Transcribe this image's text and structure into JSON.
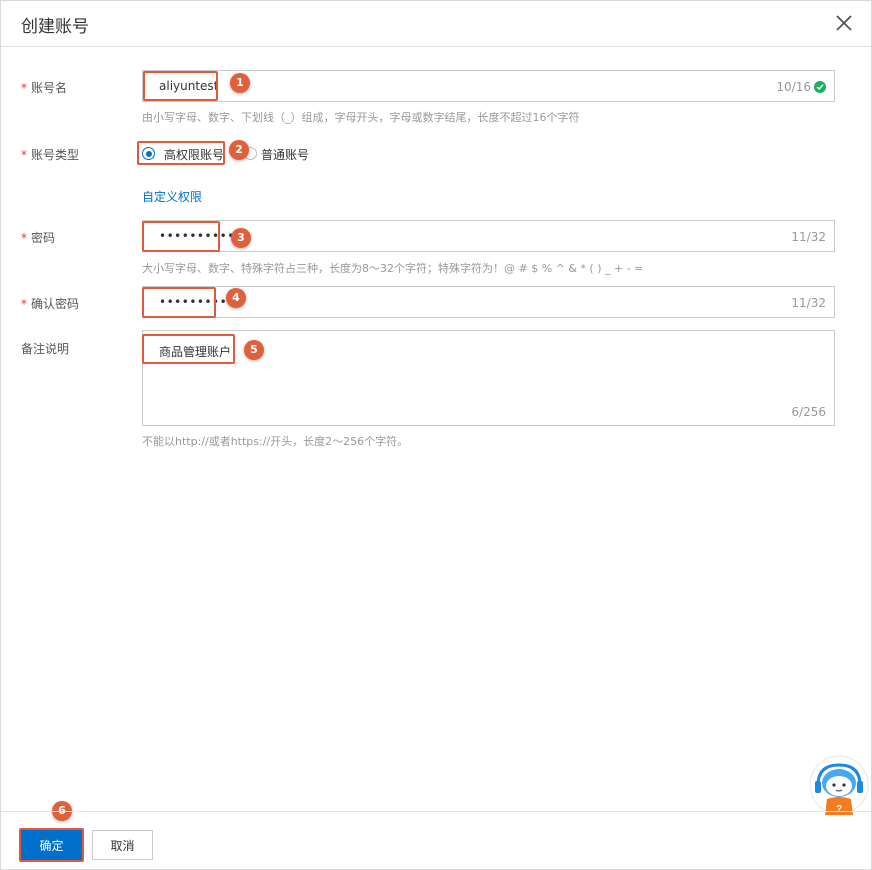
{
  "dialog": {
    "title": "创建账号"
  },
  "fields": {
    "account_name": {
      "label": "账号名",
      "value": "aliyuntest",
      "counter": "10/16",
      "hint": "由小写字母、数字、下划线（_）组成，字母开头，字母或数字结尾，长度不超过16个字符"
    },
    "account_type": {
      "label": "账号类型",
      "options": [
        "高权限账号",
        "普通账号"
      ],
      "selected": "高权限账号",
      "custom_link": "自定义权限"
    },
    "password": {
      "label": "密码",
      "value": "•••••••••••",
      "counter": "11/32",
      "hint": "大小写字母、数字、特殊字符占三种，长度为8～32个字符；特殊字符为！@ # $ % ^ & * ( ) _ + - ="
    },
    "confirm_password": {
      "label": "确认密码",
      "value": "•••••••••••",
      "counter": "11/32"
    },
    "remark": {
      "label": "备注说明",
      "value": "商品管理账户",
      "counter": "6/256",
      "hint": "不能以http://或者https://开头，长度2～256个字符。"
    }
  },
  "required_mark": "*",
  "markers": [
    "1",
    "2",
    "3",
    "4",
    "5",
    "6"
  ],
  "buttons": {
    "confirm": "确定",
    "cancel": "取消"
  },
  "colors": {
    "primary": "#0070cc",
    "highlight": "#e05a3b",
    "success": "#1aaf5d",
    "required": "#e4393c"
  },
  "icons": {
    "close": "close-icon",
    "valid": "check-circle-icon",
    "assistant": "assistant-icon"
  }
}
